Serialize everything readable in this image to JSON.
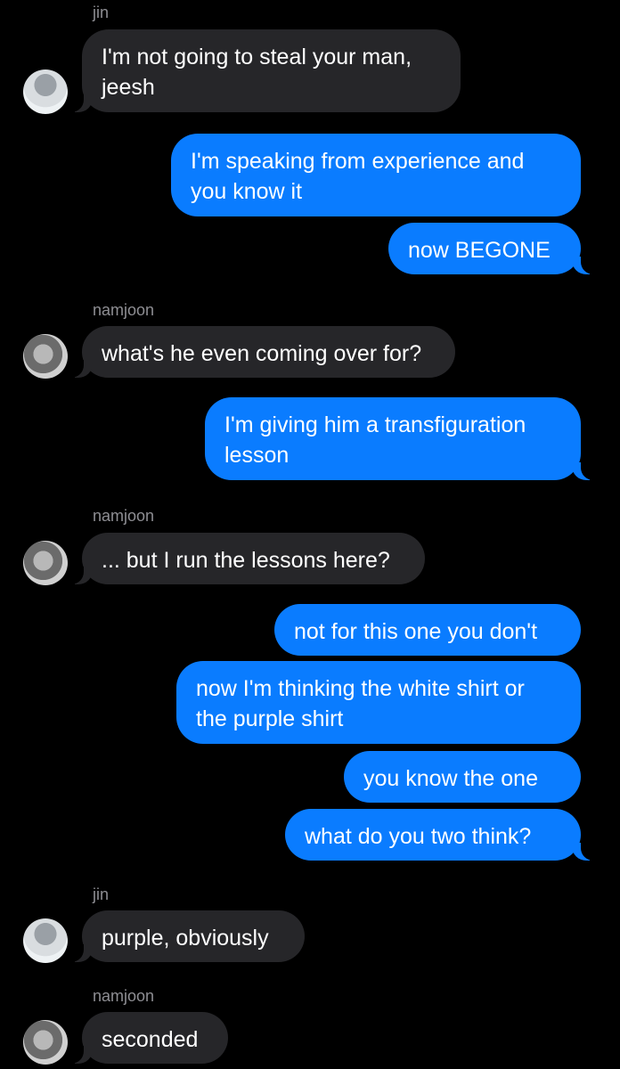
{
  "senders": {
    "jin": "jin",
    "namjoon": "namjoon"
  },
  "messages": [
    {
      "text": "I'm not going to steal your man,\njeesh"
    },
    {
      "text": "I'm speaking from experience and\nyou know it"
    },
    {
      "text": "now BEGONE"
    },
    {
      "text": "what's he even coming over for?"
    },
    {
      "text": "I'm giving him a transfiguration\nlesson"
    },
    {
      "text": "... but I run the lessons here?"
    },
    {
      "text": "not for this one you don't"
    },
    {
      "text": "now I'm thinking the white shirt or\nthe purple shirt"
    },
    {
      "text": "you know the one"
    },
    {
      "text": "what do you two think?"
    },
    {
      "text": "purple, obviously"
    },
    {
      "text": "seconded"
    }
  ],
  "colors": {
    "incoming_bubble": "#262629",
    "outgoing_bubble": "#0a7cff",
    "background": "#000000",
    "sender_name": "#8e8e93"
  }
}
